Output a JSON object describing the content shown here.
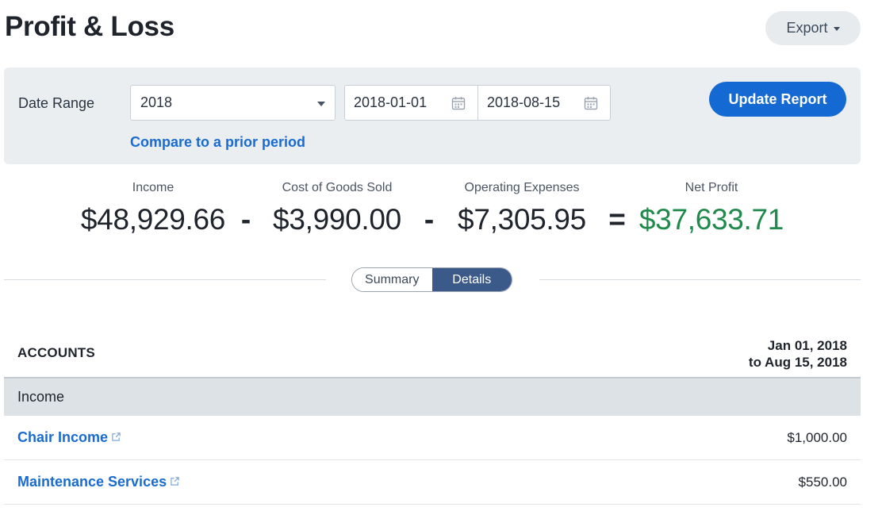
{
  "header": {
    "title": "Profit & Loss",
    "export_label": "Export"
  },
  "filters": {
    "date_range_label": "Date Range",
    "preset_value": "2018",
    "start_date": "2018-01-01",
    "end_date": "2018-08-15",
    "compare_link": "Compare to a prior period",
    "update_button": "Update Report"
  },
  "summary": {
    "income_label": "Income",
    "income_value": "$48,929.66",
    "cogs_label": "Cost of Goods Sold",
    "cogs_value": "$3,990.00",
    "opex_label": "Operating Expenses",
    "opex_value": "$7,305.95",
    "net_label": "Net Profit",
    "net_value": "$37,633.71",
    "minus": "-",
    "equals": "=",
    "net_color": "#1f8a4c"
  },
  "view_toggle": {
    "summary": "Summary",
    "details": "Details",
    "selected": "Details"
  },
  "table": {
    "accounts_header": "ACCOUNTS",
    "period_line1": "Jan 01, 2018",
    "period_line2": "to Aug 15, 2018",
    "section": "Income",
    "rows": [
      {
        "account": "Chair Income",
        "amount": "$1,000.00"
      },
      {
        "account": "Maintenance Services",
        "amount": "$550.00"
      }
    ]
  },
  "icons": {
    "calendar": "calendar-icon",
    "external_link": "external-link-icon",
    "caret": "chevron-down-icon"
  },
  "colors": {
    "accent": "#1469d3",
    "link": "#1a6bd1",
    "toggle_active": "#3b5a8a",
    "positive": "#1f8a4c"
  }
}
